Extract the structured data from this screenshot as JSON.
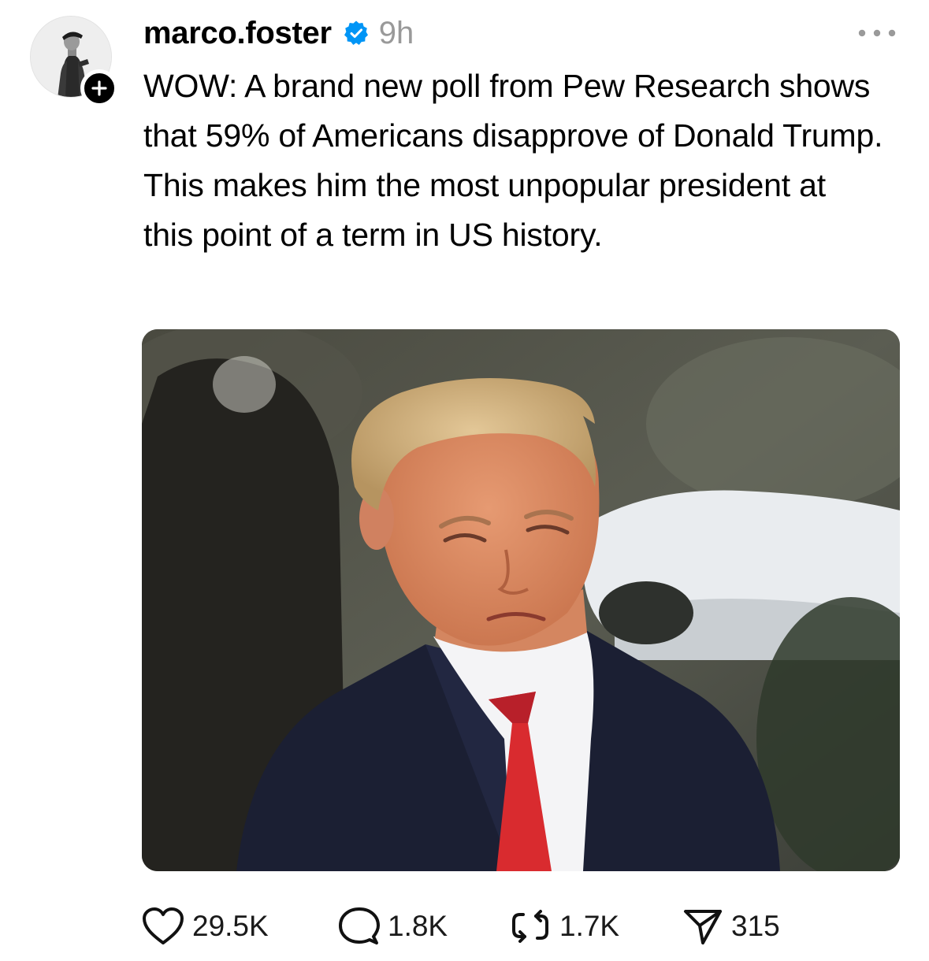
{
  "post": {
    "author": {
      "username": "marco.foster",
      "verified": true,
      "avatar_icon": "profile-photo"
    },
    "timestamp": "9h",
    "text": "WOW: A brand new poll from Pew Research shows that 59% of Americans disapprove of Donald Trump. This makes him the most unpopular president at this point of a term in US history.",
    "media": {
      "type": "photo"
    },
    "stats": {
      "likes": "29.5K",
      "replies": "1.8K",
      "reposts": "1.7K",
      "shares": "315"
    }
  },
  "icons": {
    "verified": "verified-badge-icon",
    "more": "ellipsis-icon",
    "follow": "plus-icon",
    "like": "heart-icon",
    "reply": "speech-bubble-icon",
    "repost": "repost-arrows-icon",
    "share": "paper-plane-icon"
  },
  "colors": {
    "verified": "#0095f6",
    "text": "#000000",
    "muted": "#999999"
  }
}
